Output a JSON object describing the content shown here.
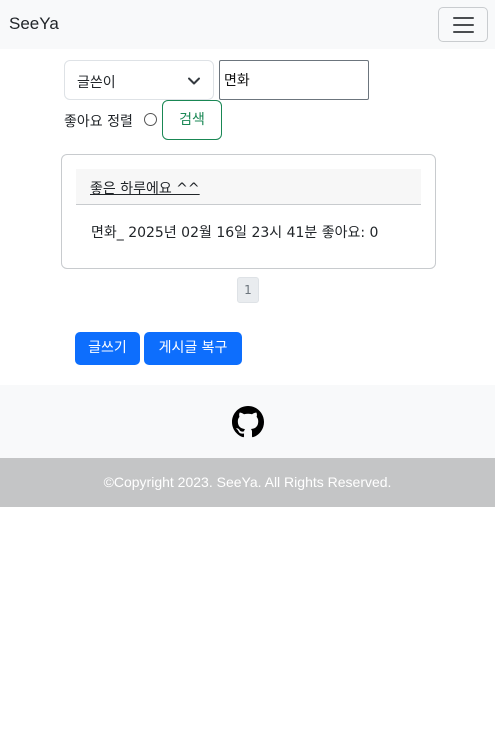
{
  "navbar": {
    "brand": "SeeYa",
    "menu_icon": "hamburger-menu-icon"
  },
  "search": {
    "field_select": "글쓴이",
    "query_value": "면화",
    "like_sort_label": "좋아요 정렬",
    "like_sort_checked": false,
    "button_label": "검색"
  },
  "posts": [
    {
      "title": "좋은 하루에요 ^^",
      "meta": "면화_ 2025년 02월 16일 23시 41분 좋아요: 0"
    }
  ],
  "pagination": {
    "pages": [
      "1"
    ],
    "current": "1"
  },
  "actions": {
    "write_label": "글쓰기",
    "restore_label": "게시글 복구"
  },
  "footer": {
    "github_icon": "github-icon",
    "copyright": "©Copyright 2023. SeeYa. All Rights Reserved."
  },
  "colors": {
    "primary": "#0d6efd",
    "success": "#198754",
    "navbar_bg": "#f8f9fa",
    "footer_bottom_bg": "#c4c5c6"
  }
}
